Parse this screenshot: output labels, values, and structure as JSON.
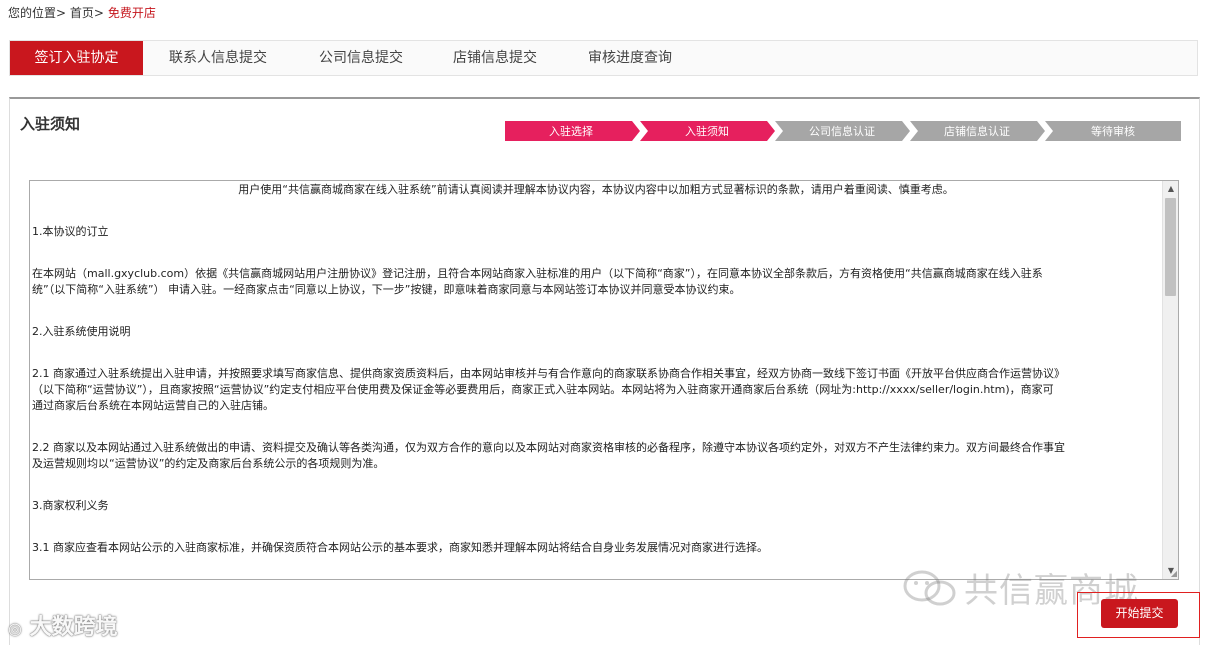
{
  "breadcrumb": {
    "location_label": "您的位置",
    "sep1": ">",
    "home": "首页",
    "sep2": ">",
    "current": "免费开店"
  },
  "tabs": [
    {
      "label": "签订入驻协定",
      "active": true
    },
    {
      "label": "联系人信息提交",
      "active": false
    },
    {
      "label": "公司信息提交",
      "active": false
    },
    {
      "label": "店铺信息提交",
      "active": false
    },
    {
      "label": "审核进度查询",
      "active": false
    }
  ],
  "panel": {
    "title": "入驻须知"
  },
  "steps": [
    {
      "label": "入驻选择",
      "state": "done"
    },
    {
      "label": "入驻须知",
      "state": "current"
    },
    {
      "label": "公司信息认证",
      "state": "todo"
    },
    {
      "label": "店铺信息认证",
      "state": "todo"
    },
    {
      "label": "等待审核",
      "state": "todo"
    }
  ],
  "step_colors": {
    "active": "#e6205e",
    "inactive": "#a6a6a6",
    "text": "#ffffff"
  },
  "agreement": {
    "intro": "用户使用“共信赢商城商家在线入驻系统”前请认真阅读并理解本协议内容，本协议内容中以加粗方式显著标识的条款，请用户着重阅读、慎重考虑。",
    "s1_title": "1.本协议的订立",
    "s1_p1_line1": "在本网站（mall.gxyclub.com）依据《共信赢商城网站用户注册协议》登记注册，且符合本网站商家入驻标准的用户（以下简称“商家”），在同意本协议全部条款后，方有资格使用“共信赢商城商家在线入驻系",
    "s1_p1_line2": "统”（以下简称“入驻系统”） 申请入驻。一经商家点击“同意以上协议，下一步”按键，即意味着商家同意与本网站签订本协议并同意受本协议约束。",
    "s2_title": "2.入驻系统使用说明",
    "s21_line1": "2.1 商家通过入驻系统提出入驻申请，并按照要求填写商家信息、提供商家资质资料后，由本网站审核并与有合作意向的商家联系协商合作相关事宜，经双方协商一致线下签订书面《开放平台供应商合作运营协议》",
    "s21_line2": "（以下简称“运营协议”），且商家按照“运营协议”约定支付相应平台使用费及保证金等必要费用后，商家正式入驻本网站。本网站将为入驻商家开通商家后台系统（网址为:http://xxxx/seller/login.htm)，商家可",
    "s21_line3": "通过商家后台系统在本网站运营自己的入驻店铺。",
    "s22_line1": "2.2 商家以及本网站通过入驻系统做出的申请、资料提交及确认等各类沟通，仅为双方合作的意向以及本网站对商家资格审核的必备程序，除遵守本协议各项约定外，对双方不产生法律约束力。双方间最终合作事宜",
    "s22_line2": "及运营规则均以“运营协议”的约定及商家后台系统公示的各项规则为准。",
    "s3_title": "3.商家权利义务",
    "s31_line1": "3.1 商家应查看本网站公示的入驻商家标准，并确保资质符合本网站公示的基本要求，商家知悉并理解本网站将结合自身业务发展情况对商家进行选择。"
  },
  "submit": {
    "label": "开始提交"
  },
  "watermarks": {
    "right": "共信赢商城",
    "left": "大数跨境"
  },
  "colors": {
    "brand_red": "#c9171e",
    "step_pink": "#e6205e",
    "step_gray": "#a6a6a6"
  }
}
